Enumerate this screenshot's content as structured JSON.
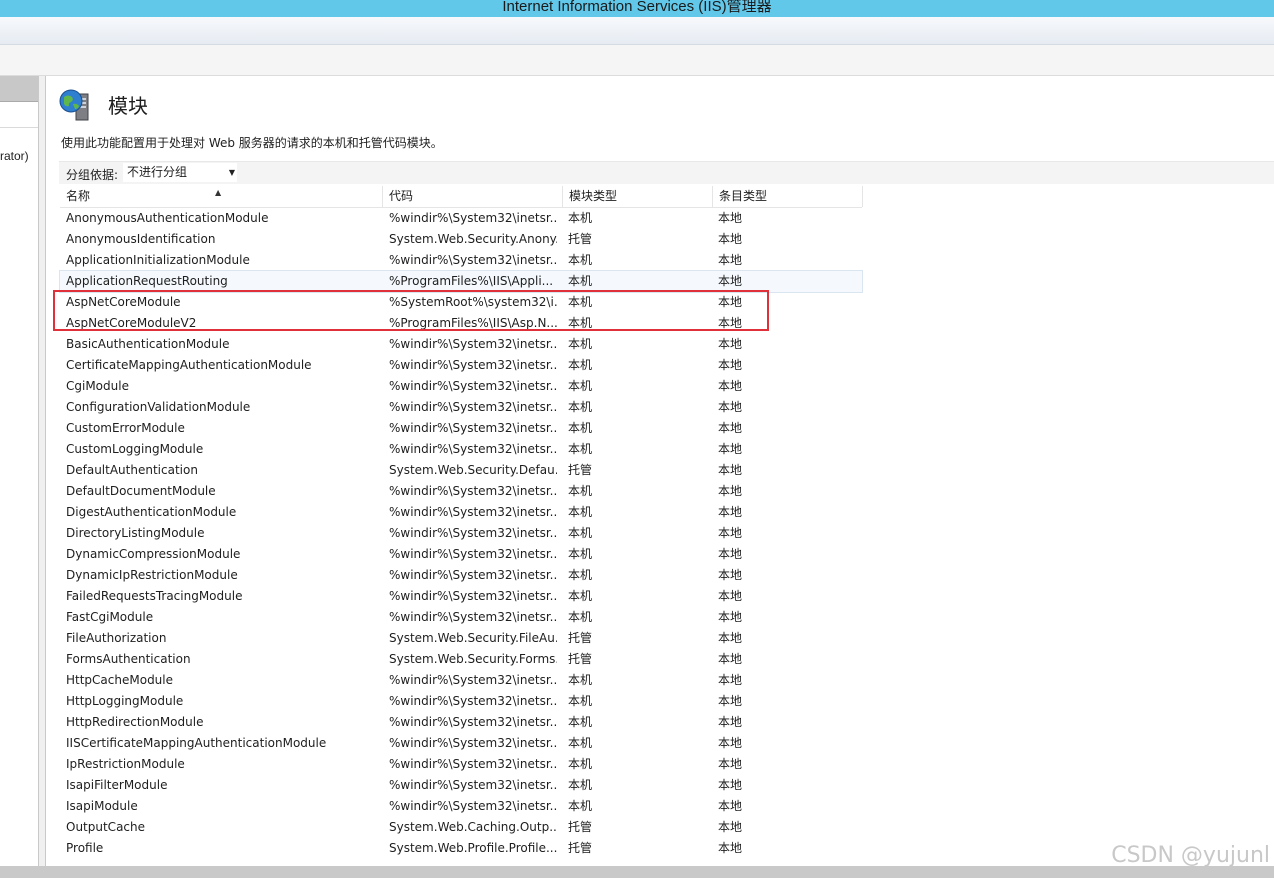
{
  "window": {
    "title": "Internet Information Services (IIS)管理器"
  },
  "left_pane": {
    "node_label": "rator)"
  },
  "page": {
    "title": "模块",
    "icon": "modules-globe-server-icon",
    "description": "使用此功能配置用于处理对 Web 服务器的请求的本机和托管代码模块。"
  },
  "group_by": {
    "label": "分组依据:",
    "value": "不进行分组"
  },
  "table": {
    "columns": [
      "名称",
      "代码",
      "模块类型",
      "条目类型"
    ],
    "sorted_column": "名称",
    "rows": [
      {
        "name": "AnonymousAuthenticationModule",
        "code": "%windir%\\System32\\inetsr...",
        "module_type": "本机",
        "entry_type": "本地"
      },
      {
        "name": "AnonymousIdentification",
        "code": "System.Web.Security.Anony...",
        "module_type": "托管",
        "entry_type": "本地"
      },
      {
        "name": "ApplicationInitializationModule",
        "code": "%windir%\\System32\\inetsr...",
        "module_type": "本机",
        "entry_type": "本地"
      },
      {
        "name": "ApplicationRequestRouting",
        "code": "%ProgramFiles%\\IIS\\Appli...",
        "module_type": "本机",
        "entry_type": "本地"
      },
      {
        "name": "AspNetCoreModule",
        "code": "%SystemRoot%\\system32\\i...",
        "module_type": "本机",
        "entry_type": "本地"
      },
      {
        "name": "AspNetCoreModuleV2",
        "code": "%ProgramFiles%\\IIS\\Asp.N...",
        "module_type": "本机",
        "entry_type": "本地"
      },
      {
        "name": "BasicAuthenticationModule",
        "code": "%windir%\\System32\\inetsr...",
        "module_type": "本机",
        "entry_type": "本地"
      },
      {
        "name": "CertificateMappingAuthenticationModule",
        "code": "%windir%\\System32\\inetsr...",
        "module_type": "本机",
        "entry_type": "本地"
      },
      {
        "name": "CgiModule",
        "code": "%windir%\\System32\\inetsr...",
        "module_type": "本机",
        "entry_type": "本地"
      },
      {
        "name": "ConfigurationValidationModule",
        "code": "%windir%\\System32\\inetsr...",
        "module_type": "本机",
        "entry_type": "本地"
      },
      {
        "name": "CustomErrorModule",
        "code": "%windir%\\System32\\inetsr...",
        "module_type": "本机",
        "entry_type": "本地"
      },
      {
        "name": "CustomLoggingModule",
        "code": "%windir%\\System32\\inetsr...",
        "module_type": "本机",
        "entry_type": "本地"
      },
      {
        "name": "DefaultAuthentication",
        "code": "System.Web.Security.Defau...",
        "module_type": "托管",
        "entry_type": "本地"
      },
      {
        "name": "DefaultDocumentModule",
        "code": "%windir%\\System32\\inetsr...",
        "module_type": "本机",
        "entry_type": "本地"
      },
      {
        "name": "DigestAuthenticationModule",
        "code": "%windir%\\System32\\inetsr...",
        "module_type": "本机",
        "entry_type": "本地"
      },
      {
        "name": "DirectoryListingModule",
        "code": "%windir%\\System32\\inetsr...",
        "module_type": "本机",
        "entry_type": "本地"
      },
      {
        "name": "DynamicCompressionModule",
        "code": "%windir%\\System32\\inetsr...",
        "module_type": "本机",
        "entry_type": "本地"
      },
      {
        "name": "DynamicIpRestrictionModule",
        "code": "%windir%\\System32\\inetsr...",
        "module_type": "本机",
        "entry_type": "本地"
      },
      {
        "name": "FailedRequestsTracingModule",
        "code": "%windir%\\System32\\inetsr...",
        "module_type": "本机",
        "entry_type": "本地"
      },
      {
        "name": "FastCgiModule",
        "code": "%windir%\\System32\\inetsr...",
        "module_type": "本机",
        "entry_type": "本地"
      },
      {
        "name": "FileAuthorization",
        "code": "System.Web.Security.FileAu...",
        "module_type": "托管",
        "entry_type": "本地"
      },
      {
        "name": "FormsAuthentication",
        "code": "System.Web.Security.Forms...",
        "module_type": "托管",
        "entry_type": "本地"
      },
      {
        "name": "HttpCacheModule",
        "code": "%windir%\\System32\\inetsr...",
        "module_type": "本机",
        "entry_type": "本地"
      },
      {
        "name": "HttpLoggingModule",
        "code": "%windir%\\System32\\inetsr...",
        "module_type": "本机",
        "entry_type": "本地"
      },
      {
        "name": "HttpRedirectionModule",
        "code": "%windir%\\System32\\inetsr...",
        "module_type": "本机",
        "entry_type": "本地"
      },
      {
        "name": "IISCertificateMappingAuthenticationModule",
        "code": "%windir%\\System32\\inetsr...",
        "module_type": "本机",
        "entry_type": "本地"
      },
      {
        "name": "IpRestrictionModule",
        "code": "%windir%\\System32\\inetsr...",
        "module_type": "本机",
        "entry_type": "本地"
      },
      {
        "name": "IsapiFilterModule",
        "code": "%windir%\\System32\\inetsr...",
        "module_type": "本机",
        "entry_type": "本地"
      },
      {
        "name": "IsapiModule",
        "code": "%windir%\\System32\\inetsr...",
        "module_type": "本机",
        "entry_type": "本地"
      },
      {
        "name": "OutputCache",
        "code": "System.Web.Caching.Outp...",
        "module_type": "托管",
        "entry_type": "本地"
      },
      {
        "name": "Profile",
        "code": "System.Web.Profile.Profile...",
        "module_type": "托管",
        "entry_type": "本地"
      }
    ],
    "selected_row": "ApplicationRequestRouting",
    "highlighted_rows": [
      "AspNetCoreModule",
      "AspNetCoreModuleV2"
    ],
    "highlight_color": "#e0313a"
  },
  "watermark": "CSDN @yujunl",
  "colors": {
    "titlebar": "#62c8ea"
  }
}
